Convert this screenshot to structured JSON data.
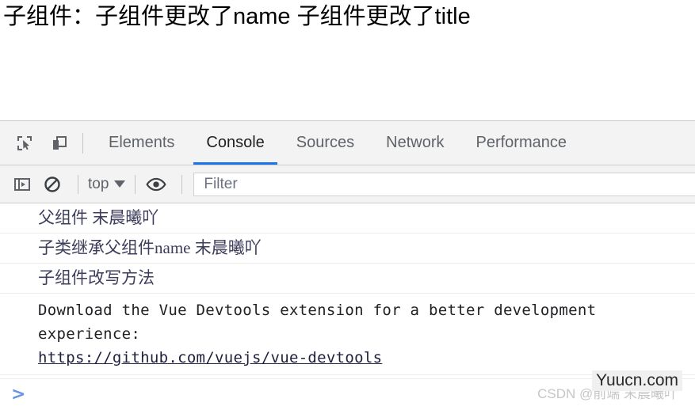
{
  "page": {
    "title": "子组件：子组件更改了name 子组件更改了title"
  },
  "devtools": {
    "icons": {
      "inspect": "inspect-element-icon",
      "device": "device-toolbar-icon"
    },
    "tabs": [
      {
        "label": "Elements",
        "active": false
      },
      {
        "label": "Console",
        "active": true
      },
      {
        "label": "Sources",
        "active": false
      },
      {
        "label": "Network",
        "active": false
      },
      {
        "label": "Performance",
        "active": false
      }
    ],
    "active_tab_accent": "#1a73e8",
    "console_toolbar": {
      "sidebar_icon": "console-sidebar-icon",
      "clear_icon": "clear-console-icon",
      "context": "top",
      "eye_icon": "live-expression-icon",
      "filter_placeholder": "Filter"
    },
    "console_messages": [
      {
        "kind": "cn",
        "text": "父组件 末晨曦吖"
      },
      {
        "kind": "cn",
        "text": "子类继承父组件name 末晨曦吖"
      },
      {
        "kind": "cn",
        "text": "子组件改写方法"
      },
      {
        "kind": "mono",
        "text": "Download the Vue Devtools extension for a better development experience:",
        "url": "https://github.com/vuejs/vue-devtools"
      }
    ],
    "prompt": ">"
  },
  "watermarks": {
    "csdn": "CSDN @前端 末晨曦吖",
    "yuucn": "Yuucn.com"
  }
}
